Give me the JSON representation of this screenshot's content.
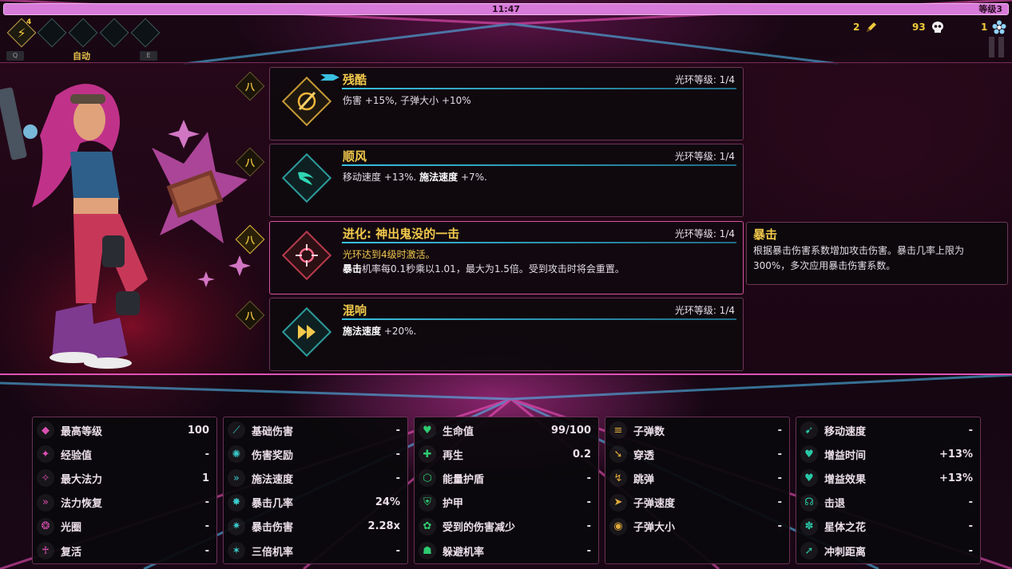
{
  "top": {
    "timer": "11:47",
    "level": "等级3",
    "skill_count": "4",
    "keys": [
      "Q",
      "E"
    ],
    "auto_label": "自动",
    "resources": [
      {
        "value": "2",
        "icon": "pencil-icon"
      },
      {
        "value": "93",
        "icon": "skull-icon"
      },
      {
        "value": "1",
        "icon": "flower-icon"
      }
    ]
  },
  "auras": [
    {
      "title": "残酷",
      "level": "光环等级: 1/4",
      "desc_parts": [
        "伤害 +15%, 子弹大小 +10%"
      ],
      "icon": "slash-icon"
    },
    {
      "title": "顺风",
      "level": "光环等级: 1/4",
      "desc_a": "移动速度 +13%. ",
      "desc_b": "施法速度",
      "desc_c": " +7%.",
      "icon": "wind-wing-icon"
    },
    {
      "title": "进化: 神出鬼没的一击",
      "level": "光环等级: 1/4",
      "line1": "光环达到4级时激活。",
      "line2_bold": "暴击",
      "line2": "机率每0.1秒乘以1.01，最大为1.5倍。受到攻击时将会重置。",
      "icon": "crit-burst-icon"
    },
    {
      "title": "混响",
      "level": "光环等级: 1/4",
      "desc_bold": "施法速度",
      "desc": " +20%.",
      "icon": "fast-forward-icon"
    }
  ],
  "side_badge_symbol": "八",
  "tooltip": {
    "title": "暴击",
    "body": "根据暴击伤害系数增加攻击伤害。暴击几率上限为300%，多次应用暴击伤害系数。"
  },
  "stats": [
    [
      {
        "name": "最高等级",
        "value": "100",
        "icon": "level-icon"
      },
      {
        "name": "经验值",
        "value": "-",
        "icon": "xp-icon"
      },
      {
        "name": "最大法力",
        "value": "1",
        "icon": "mana-icon"
      },
      {
        "name": "法力恢复",
        "value": "-",
        "icon": "mana-regen-icon"
      },
      {
        "name": "光圈",
        "value": "-",
        "icon": "aura-ring-icon"
      },
      {
        "name": "复活",
        "value": "-",
        "icon": "revive-icon"
      }
    ],
    [
      {
        "name": "基础伤害",
        "value": "-",
        "icon": "damage-icon"
      },
      {
        "name": "伤害奖励",
        "value": "-",
        "icon": "damage-bonus-icon"
      },
      {
        "name": "施法速度",
        "value": "-",
        "icon": "cast-speed-icon"
      },
      {
        "name": "暴击几率",
        "value": "24%",
        "icon": "crit-chance-icon"
      },
      {
        "name": "暴击伤害",
        "value": "2.28x",
        "icon": "crit-damage-icon"
      },
      {
        "name": "三倍机率",
        "value": "-",
        "icon": "triple-icon"
      }
    ],
    [
      {
        "name": "生命值",
        "value": "99/100",
        "icon": "heart-icon"
      },
      {
        "name": "再生",
        "value": "0.2",
        "icon": "regen-icon"
      },
      {
        "name": "能量护盾",
        "value": "-",
        "icon": "energy-shield-icon"
      },
      {
        "name": "护甲",
        "value": "-",
        "icon": "armor-icon"
      },
      {
        "name": "受到的伤害减少",
        "value": "-",
        "icon": "damage-reduction-icon"
      },
      {
        "name": "躲避机率",
        "value": "-",
        "icon": "dodge-icon"
      }
    ],
    [
      {
        "name": "子弹数",
        "value": "-",
        "icon": "bullet-count-icon"
      },
      {
        "name": "穿透",
        "value": "-",
        "icon": "pierce-icon"
      },
      {
        "name": "跳弹",
        "value": "-",
        "icon": "bounce-icon"
      },
      {
        "name": "子弹速度",
        "value": "-",
        "icon": "bullet-speed-icon"
      },
      {
        "name": "子弹大小",
        "value": "-",
        "icon": "bullet-size-icon"
      }
    ],
    [
      {
        "name": "移动速度",
        "value": "-",
        "icon": "move-speed-icon"
      },
      {
        "name": "增益时间",
        "value": "+13%",
        "icon": "buff-time-icon"
      },
      {
        "name": "增益效果",
        "value": "+13%",
        "icon": "buff-effect-icon"
      },
      {
        "name": "击退",
        "value": "-",
        "icon": "knockback-icon"
      },
      {
        "name": "星体之花",
        "value": "-",
        "icon": "astral-flower-icon"
      },
      {
        "name": "冲刺距离",
        "value": "-",
        "icon": "dash-icon"
      }
    ]
  ],
  "colors": {
    "accent": "#f2c94c",
    "pink": "#e052b6",
    "teal": "#39c0e0"
  }
}
